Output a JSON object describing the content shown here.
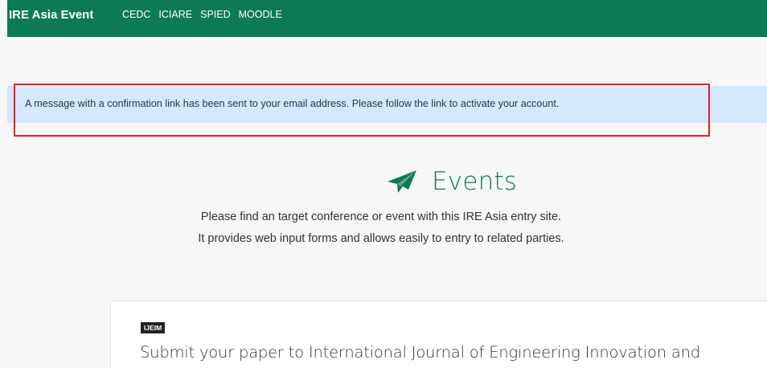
{
  "navbar": {
    "brand": "IRE Asia Event",
    "links": [
      "CEDC",
      "ICIARE",
      "SPIED",
      "MOODLE"
    ],
    "background": "#0e7a55"
  },
  "alert": {
    "message": "A message with a confirmation link has been sent to your email address. Please follow the link to activate your account.",
    "background": "#d6e8fb",
    "highlight_color": "#e0202a"
  },
  "hero": {
    "icon": "paper-plane-icon",
    "title": "Events",
    "subtitle_line1": "Please find an target conference or event with this IRE Asia entry site.",
    "subtitle_line2": "It provides web input forms and allows easily to entry to related parties.",
    "accent": "#0e7a55"
  },
  "event_card": {
    "badge": "IJEIM",
    "title": "Submit your paper to International Journal of Engineering Innovation and"
  }
}
